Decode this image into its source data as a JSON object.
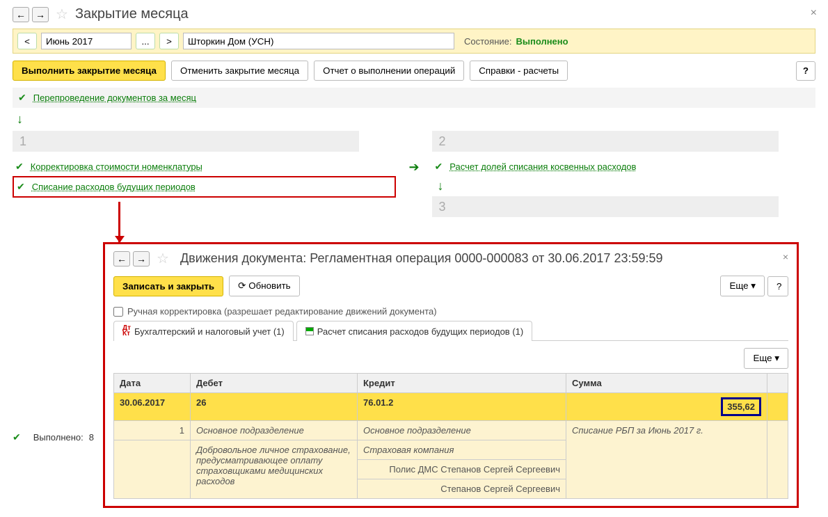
{
  "header": {
    "title": "Закрытие месяца"
  },
  "toolbar": {
    "period": "Июнь 2017",
    "org": "Шторкин Дом (УСН)",
    "state_label": "Состояние:",
    "state_value": "Выполнено"
  },
  "cmd": {
    "execute": "Выполнить закрытие месяца",
    "cancel": "Отменить закрытие месяца",
    "report": "Отчет о выполнении операций",
    "refs": "Справки - расчеты",
    "help": "?"
  },
  "stage0": "Перепроведение документов за месяц",
  "col1": {
    "num": "1",
    "task1": "Корректировка стоимости номенклатуры",
    "task2": "Списание расходов будущих периодов"
  },
  "col2": {
    "num": "2",
    "task1": "Расчет долей списания косвенных расходов",
    "num3": "3"
  },
  "footer": {
    "label": "Выполнено:",
    "count": "8"
  },
  "modal": {
    "title": "Движения документа: Регламентная операция 0000-000083 от 30.06.2017 23:59:59",
    "save": "Записать и закрыть",
    "refresh": "Обновить",
    "more": "Еще",
    "help": "?",
    "chk_label": "Ручная корректировка (разрешает редактирование движений документа)",
    "tab1": "Бухгалтерский и налоговый учет (1)",
    "tab2": "Расчет списания расходов будущих периодов (1)"
  },
  "table": {
    "headers": {
      "date": "Дата",
      "debit": "Дебет",
      "credit": "Кредит",
      "sum": "Сумма"
    },
    "row1": {
      "date": "30.06.2017",
      "debit": "26",
      "credit": "76.01.2",
      "sum": "355,62"
    },
    "row2": {
      "n": "1",
      "debit": "Основное подразделение",
      "credit": "Основное подразделение",
      "note": "Списание РБП за Июнь 2017 г."
    },
    "row3": {
      "debit": "Добровольное личное страхование, предусматривающее оплату страховщиками медицинских расходов",
      "credit1": "Страховая компания",
      "credit2": "Полис ДМС Степанов Сергей Сергеевич",
      "credit3": "Степанов Сергей Сергеевич"
    }
  }
}
